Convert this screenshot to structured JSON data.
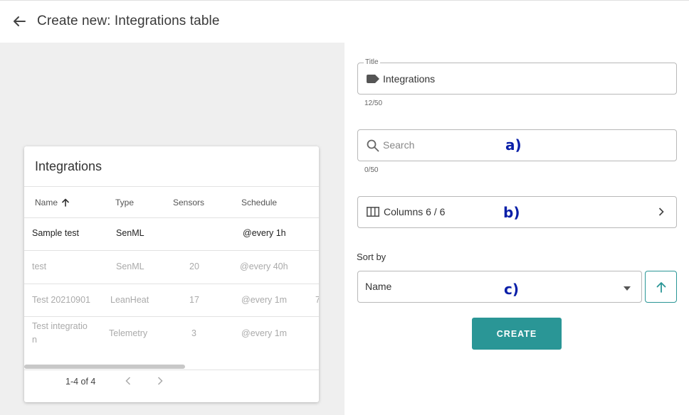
{
  "header": {
    "title": "Create new: Integrations table"
  },
  "preview": {
    "title": "Integrations",
    "columns": [
      "Name",
      "Type",
      "Sensors",
      "Schedule"
    ],
    "rows": [
      {
        "name": "Sample test",
        "type": "SenML",
        "sensors": "",
        "schedule": "@every 1h"
      },
      {
        "name": "test",
        "type": "SenML",
        "sensors": "20",
        "schedule": "@every 40h"
      },
      {
        "name": "Test 20210901",
        "type": "LeanHeat",
        "sensors": "17",
        "schedule": "@every 1m",
        "extra": "7"
      },
      {
        "name_line1": "Test integratio",
        "name_line2": "n",
        "type": "Telemetry",
        "sensors": "3",
        "schedule": "@every 1m"
      }
    ],
    "pagination": {
      "range": "1-4 of 4"
    }
  },
  "form": {
    "title_field": {
      "label": "Title",
      "value": "Integrations",
      "counter": "12/50"
    },
    "search_field": {
      "placeholder": "Search",
      "counter": "0/50"
    },
    "columns_field": {
      "label": "Columns 6 / 6"
    },
    "sort_by": {
      "label": "Sort by",
      "selected": "Name"
    },
    "create_label": "CREATE"
  },
  "annotations": {
    "a": "a)",
    "b": "b)",
    "c": "c)"
  },
  "colors": {
    "accent": "#2a9696",
    "annotation": "#0a1fa8",
    "panel_bg": "#efefef"
  }
}
